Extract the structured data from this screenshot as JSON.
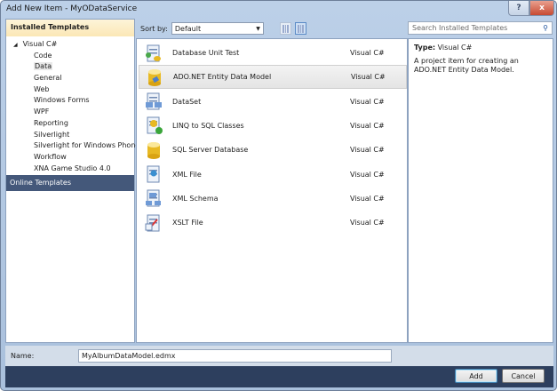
{
  "window": {
    "title": "Add New Item - MyODataService",
    "help_icon": "?",
    "close_icon": "x"
  },
  "left": {
    "header": "Installed Templates",
    "root": "Visual C#",
    "items": [
      "Code",
      "Data",
      "General",
      "Web",
      "Windows Forms",
      "WPF",
      "Reporting",
      "Silverlight",
      "Silverlight for Windows Phone",
      "Workflow",
      "XNA Game Studio 4.0"
    ],
    "selected": "Data",
    "online": "Online Templates"
  },
  "toolbar": {
    "sort_label": "Sort by:",
    "sort_value": "Default"
  },
  "search": {
    "placeholder": "Search Installed Templates"
  },
  "templates": [
    {
      "name": "Database Unit Test",
      "lang": "Visual C#",
      "icon": "database-unit-test-icon"
    },
    {
      "name": "ADO.NET Entity Data Model",
      "lang": "Visual C#",
      "icon": "entity-model-icon"
    },
    {
      "name": "DataSet",
      "lang": "Visual C#",
      "icon": "dataset-icon"
    },
    {
      "name": "LINQ to SQL Classes",
      "lang": "Visual C#",
      "icon": "linq-icon"
    },
    {
      "name": "SQL Server Database",
      "lang": "Visual C#",
      "icon": "database-icon"
    },
    {
      "name": "XML File",
      "lang": "Visual C#",
      "icon": "xml-file-icon"
    },
    {
      "name": "XML Schema",
      "lang": "Visual C#",
      "icon": "xml-schema-icon"
    },
    {
      "name": "XSLT File",
      "lang": "Visual C#",
      "icon": "xslt-file-icon"
    }
  ],
  "selected_template": "ADO.NET Entity Data Model",
  "details": {
    "type_label": "Type:",
    "type_value": "Visual C#",
    "description": "A project item for creating an ADO.NET Entity Data Model."
  },
  "name": {
    "label": "Name:",
    "value": "MyAlbumDataModel.edmx"
  },
  "buttons": {
    "add": "Add",
    "cancel": "Cancel"
  }
}
